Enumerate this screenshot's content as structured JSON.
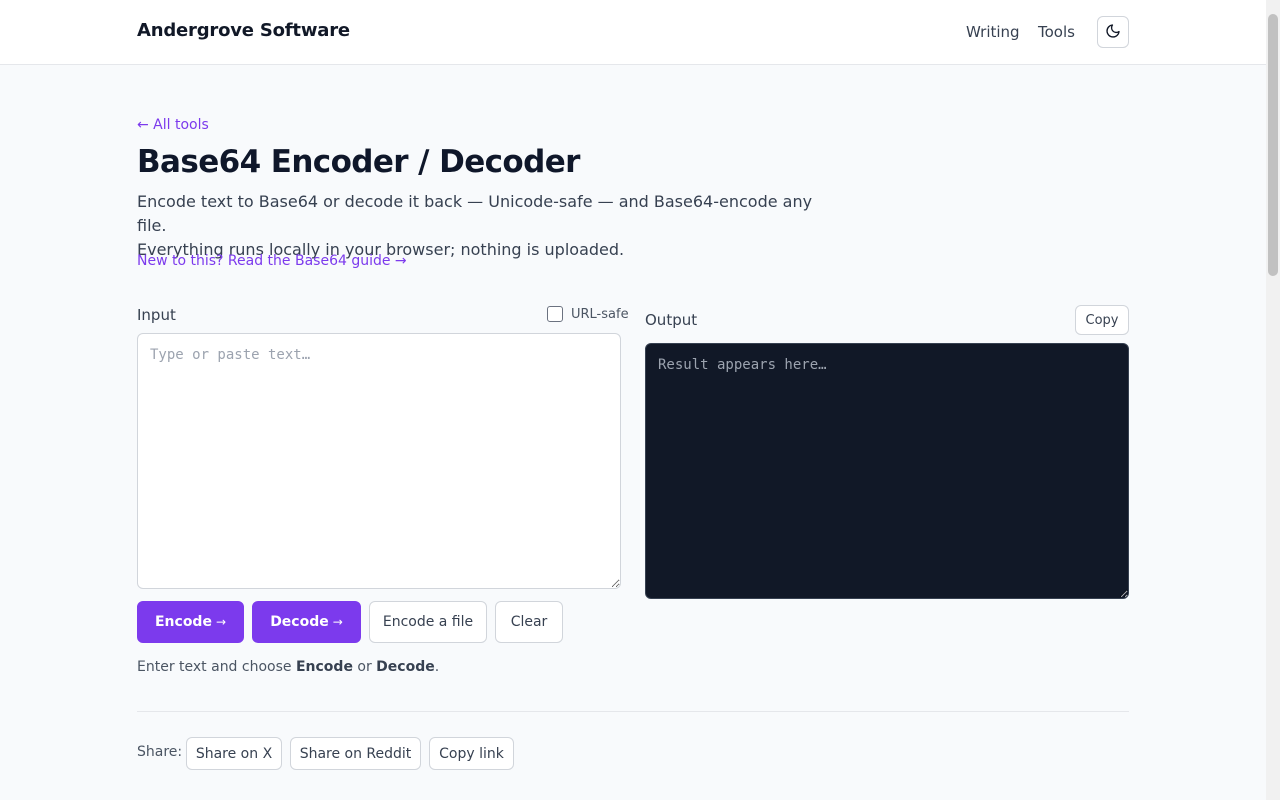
{
  "header": {
    "brand": "Andergrove Software",
    "nav": [
      {
        "label": "Writing"
      },
      {
        "label": "Tools"
      }
    ],
    "theme_toggle_icon": "moon-icon"
  },
  "page": {
    "back_link": "← All tools",
    "title": "Base64 Encoder / Decoder",
    "description_line1": "Encode text to Base64 or decode it back — Unicode-safe — and Base64-encode any file.",
    "description_line2": "Everything runs locally in your browser; nothing is uploaded.",
    "guide_link": "New to this? Read the Base64 guide →"
  },
  "input": {
    "label": "Input",
    "url_safe_label": "URL-safe",
    "url_safe_checked": false,
    "value": "",
    "placeholder": "Type or paste text…"
  },
  "output": {
    "label": "Output",
    "copy_label": "Copy",
    "value": "",
    "placeholder": "Result appears here…"
  },
  "actions": {
    "encode": "Encode",
    "decode": "Decode",
    "arrow": "→",
    "encode_file": "Encode a file",
    "clear": "Clear"
  },
  "hint": {
    "prefix": "Enter text and choose ",
    "encode": "Encode",
    "middle": " or ",
    "decode": "Decode",
    "suffix": "."
  },
  "share": {
    "label": "Share:",
    "x": "Share on X",
    "reddit": "Share on Reddit",
    "copy_link": "Copy link"
  },
  "colors": {
    "accent": "#7c3aed",
    "output_bg": "#111827"
  }
}
